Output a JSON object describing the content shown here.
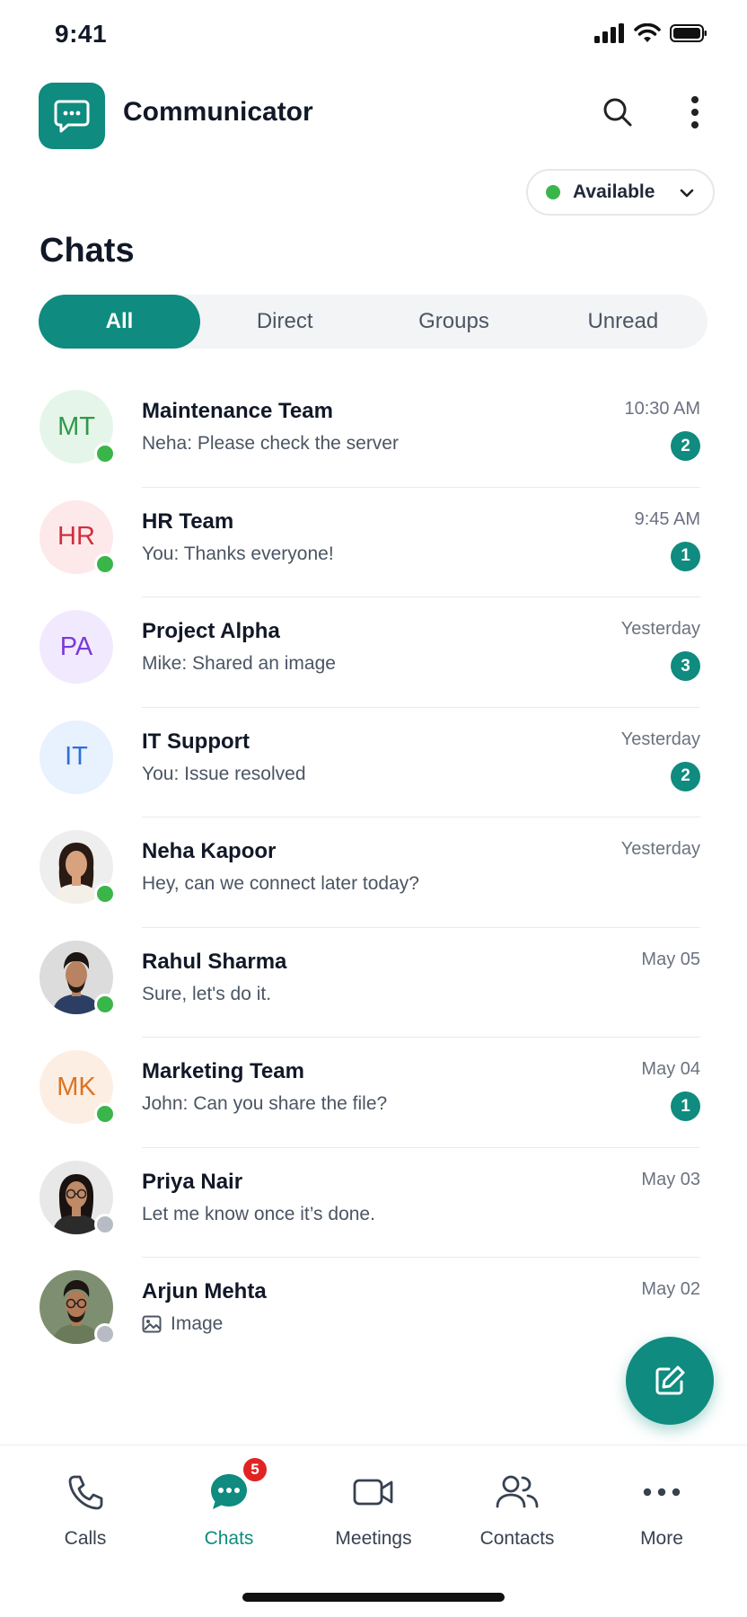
{
  "status_bar": {
    "time": "9:41"
  },
  "app": {
    "title": "Communicator",
    "icons": {
      "logo": "chat-bubble-icon",
      "search": "search-icon",
      "more": "more-vertical-icon"
    }
  },
  "presence": {
    "label": "Available",
    "color": "#3ab54a"
  },
  "page": {
    "title": "Chats"
  },
  "tabs": [
    {
      "label": "All",
      "active": true
    },
    {
      "label": "Direct",
      "active": false
    },
    {
      "label": "Groups",
      "active": false
    },
    {
      "label": "Unread",
      "active": false
    }
  ],
  "chats": [
    {
      "name": "Maintenance Team",
      "initials": "MT",
      "preview": "Neha: Please check the server",
      "time": "10:30 AM",
      "unread": "2",
      "status": "online",
      "avatar_bg": "#e6f5ea",
      "avatar_fg": "#2e9a49"
    },
    {
      "name": "HR Team",
      "initials": "HR",
      "preview": "You: Thanks everyone!",
      "time": "9:45 AM",
      "unread": "1",
      "status": "online",
      "avatar_bg": "#fde8ea",
      "avatar_fg": "#d12d3e"
    },
    {
      "name": "Project Alpha",
      "initials": "PA",
      "preview": "Mike: Shared an image",
      "time": "Yesterday",
      "unread": "3",
      "status": "",
      "avatar_bg": "#f1eafe",
      "avatar_fg": "#7b3ad8"
    },
    {
      "name": "IT Support",
      "initials": "IT",
      "preview": "You: Issue resolved",
      "time": "Yesterday",
      "unread": "2",
      "status": "",
      "avatar_bg": "#e8f1fe",
      "avatar_fg": "#2d6fd8"
    },
    {
      "name": "Neha Kapoor",
      "initials": "",
      "photo": "woman-1",
      "preview": "Hey, can we connect later today?",
      "time": "Yesterday",
      "unread": "",
      "status": "online"
    },
    {
      "name": "Rahul Sharma",
      "initials": "",
      "photo": "man-1",
      "preview": "Sure, let's do it.",
      "time": "May 05",
      "unread": "",
      "status": "online"
    },
    {
      "name": "Marketing Team",
      "initials": "MK",
      "preview": "John: Can you share the file?",
      "time": "May 04",
      "unread": "1",
      "status": "online",
      "avatar_bg": "#fdeee3",
      "avatar_fg": "#dd7421"
    },
    {
      "name": "Priya Nair",
      "initials": "",
      "photo": "woman-2",
      "preview": "Let me know once it’s done.",
      "time": "May 03",
      "unread": "",
      "status": "offline"
    },
    {
      "name": "Arjun Mehta",
      "initials": "",
      "photo": "man-2",
      "preview": "Image",
      "preview_icon": "image-icon",
      "time": "May 02",
      "unread": "",
      "status": "offline"
    }
  ],
  "fab": {
    "icon": "compose-icon"
  },
  "nav": [
    {
      "label": "Calls",
      "icon": "phone-icon",
      "active": false
    },
    {
      "label": "Chats",
      "icon": "chat-bubble-icon",
      "active": true,
      "badge": "5"
    },
    {
      "label": "Meetings",
      "icon": "video-icon",
      "active": false
    },
    {
      "label": "Contacts",
      "icon": "contacts-icon",
      "active": false
    },
    {
      "label": "More",
      "icon": "more-horizontal-icon",
      "active": false
    }
  ],
  "colors": {
    "accent": "#0f8b7f",
    "online": "#3ab54a",
    "offline": "#b7bcc4",
    "badge": "#e02424"
  }
}
